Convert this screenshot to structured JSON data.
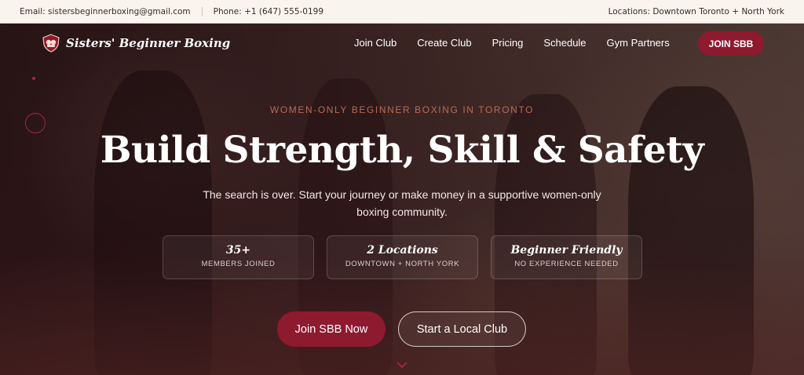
{
  "topbar": {
    "email": "Email: sistersbeginnerboxing@gmail.com",
    "phone": "Phone: +1 (647) 555-0199",
    "locations": "Locations: Downtown Toronto + North York"
  },
  "nav": {
    "brand": "Sisters' Beginner Boxing",
    "links": [
      "Join Club",
      "Create Club",
      "Pricing",
      "Schedule",
      "Gym Partners"
    ],
    "cta_label": "JOIN SBB"
  },
  "hero": {
    "eyebrow": "WOMEN-ONLY BEGINNER BOXING IN TORONTO",
    "headline": "Build Strength, Skill & Safety",
    "subtext": "The search is over. Start your journey or make money in a supportive women-only boxing community.",
    "stats": [
      {
        "value": "35+",
        "label": "MEMBERS JOINED"
      },
      {
        "value": "2 Locations",
        "label": "DOWNTOWN + NORTH YORK"
      },
      {
        "value": "Beginner Friendly",
        "label": "NO EXPERIENCE NEEDED"
      }
    ],
    "primary_cta": "Join SBB Now",
    "secondary_cta": "Start a Local Club"
  },
  "icons": {
    "logo": "boxing-glove-shield-icon",
    "scroll": "chevron-down-icon"
  },
  "colors": {
    "brand": "#8e1a2f",
    "eyebrow": "#b76b55",
    "topbar_bg": "#faf4ee"
  }
}
